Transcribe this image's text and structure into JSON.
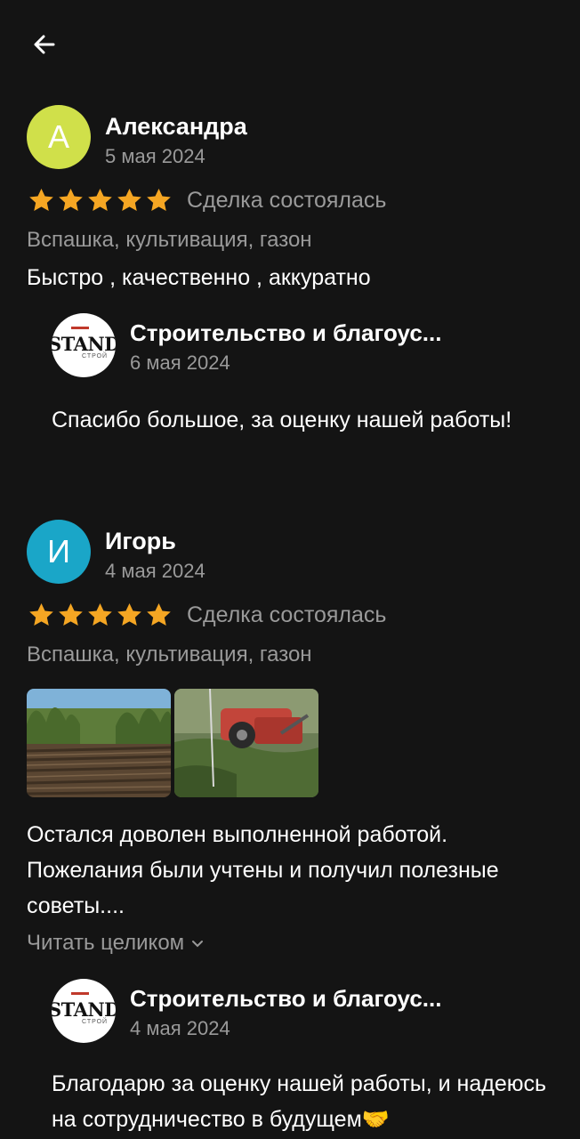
{
  "header": {
    "back_icon": "arrow-left-icon"
  },
  "reviews": [
    {
      "avatar_letter": "А",
      "avatar_color": "#d0e04a",
      "name": "Александра",
      "date": "5 мая 2024",
      "rating": 5,
      "status": "Сделка состоялась",
      "services": "Вспашка, культивация, газон",
      "text": "Быстро , качественно , аккуратно",
      "reply": {
        "logo_text": "STANDART",
        "logo_sub": "СТРОЙ",
        "company": "Строительство и благоус...",
        "date": "6 мая 2024",
        "text": "Спасибо большое, за оценку нашей работы!"
      }
    },
    {
      "avatar_letter": "И",
      "avatar_color": "#1aa6c8",
      "name": "Игорь",
      "date": "4 мая 2024",
      "rating": 5,
      "status": "Сделка состоялась",
      "services": "Вспашка, культивация, газон",
      "text": "Остался доволен выполненной работой. Пожелания были учтены и получил полезные советы....",
      "read_more": "Читать целиком",
      "reply": {
        "logo_text": "STANDART",
        "logo_sub": "СТРОЙ",
        "company": "Строительство и благоус...",
        "date": "4 мая 2024",
        "text": "Благодарю за оценку нашей работы, и надеюсь на сотрудничество в будущем🤝"
      }
    }
  ],
  "colors": {
    "star": "#f5a623",
    "muted": "#9a9a9a",
    "background": "#141414"
  }
}
